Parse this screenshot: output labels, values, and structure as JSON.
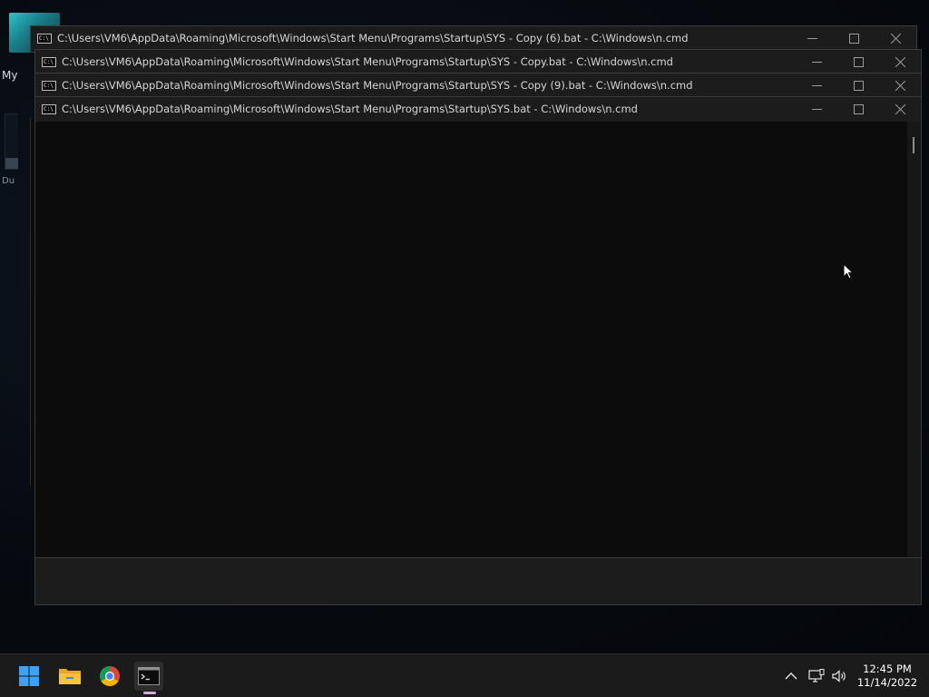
{
  "desktop": {
    "icon_label_top": "My",
    "icon_label_mid": "Du"
  },
  "windows": [
    {
      "title": "C:\\Users\\VM6\\AppData\\Roaming\\Microsoft\\Windows\\Start Menu\\Programs\\Startup\\SYS - Copy (6).bat - C:\\Windows\\n.cmd"
    },
    {
      "title": "C:\\Users\\VM6\\AppData\\Roaming\\Microsoft\\Windows\\Start Menu\\Programs\\Startup\\SYS - Copy.bat - C:\\Windows\\n.cmd"
    },
    {
      "title": "C:\\Users\\VM6\\AppData\\Roaming\\Microsoft\\Windows\\Start Menu\\Programs\\Startup\\SYS - Copy (9).bat - C:\\Windows\\n.cmd"
    },
    {
      "title": "C:\\Users\\VM6\\AppData\\Roaming\\Microsoft\\Windows\\Start Menu\\Programs\\Startup\\SYS.bat - C:\\Windows\\n.cmd"
    }
  ],
  "cmd_icon_glyph": "C:\\",
  "taskbar": {
    "apps": [
      "start-icon",
      "file-explorer-icon",
      "chrome-icon",
      "command-prompt-icon"
    ],
    "active_app": "command-prompt-icon",
    "tray": [
      "chevron-up-icon",
      "network-icon",
      "volume-icon"
    ],
    "time": "12:45 PM",
    "date": "11/14/2022"
  },
  "colors": {
    "console_bg": "#0c0c0c",
    "titlebar_bg": "#1c1c1c",
    "taskbar_bg": "#1b1b1b",
    "start_blue": "#3aa3f5"
  }
}
